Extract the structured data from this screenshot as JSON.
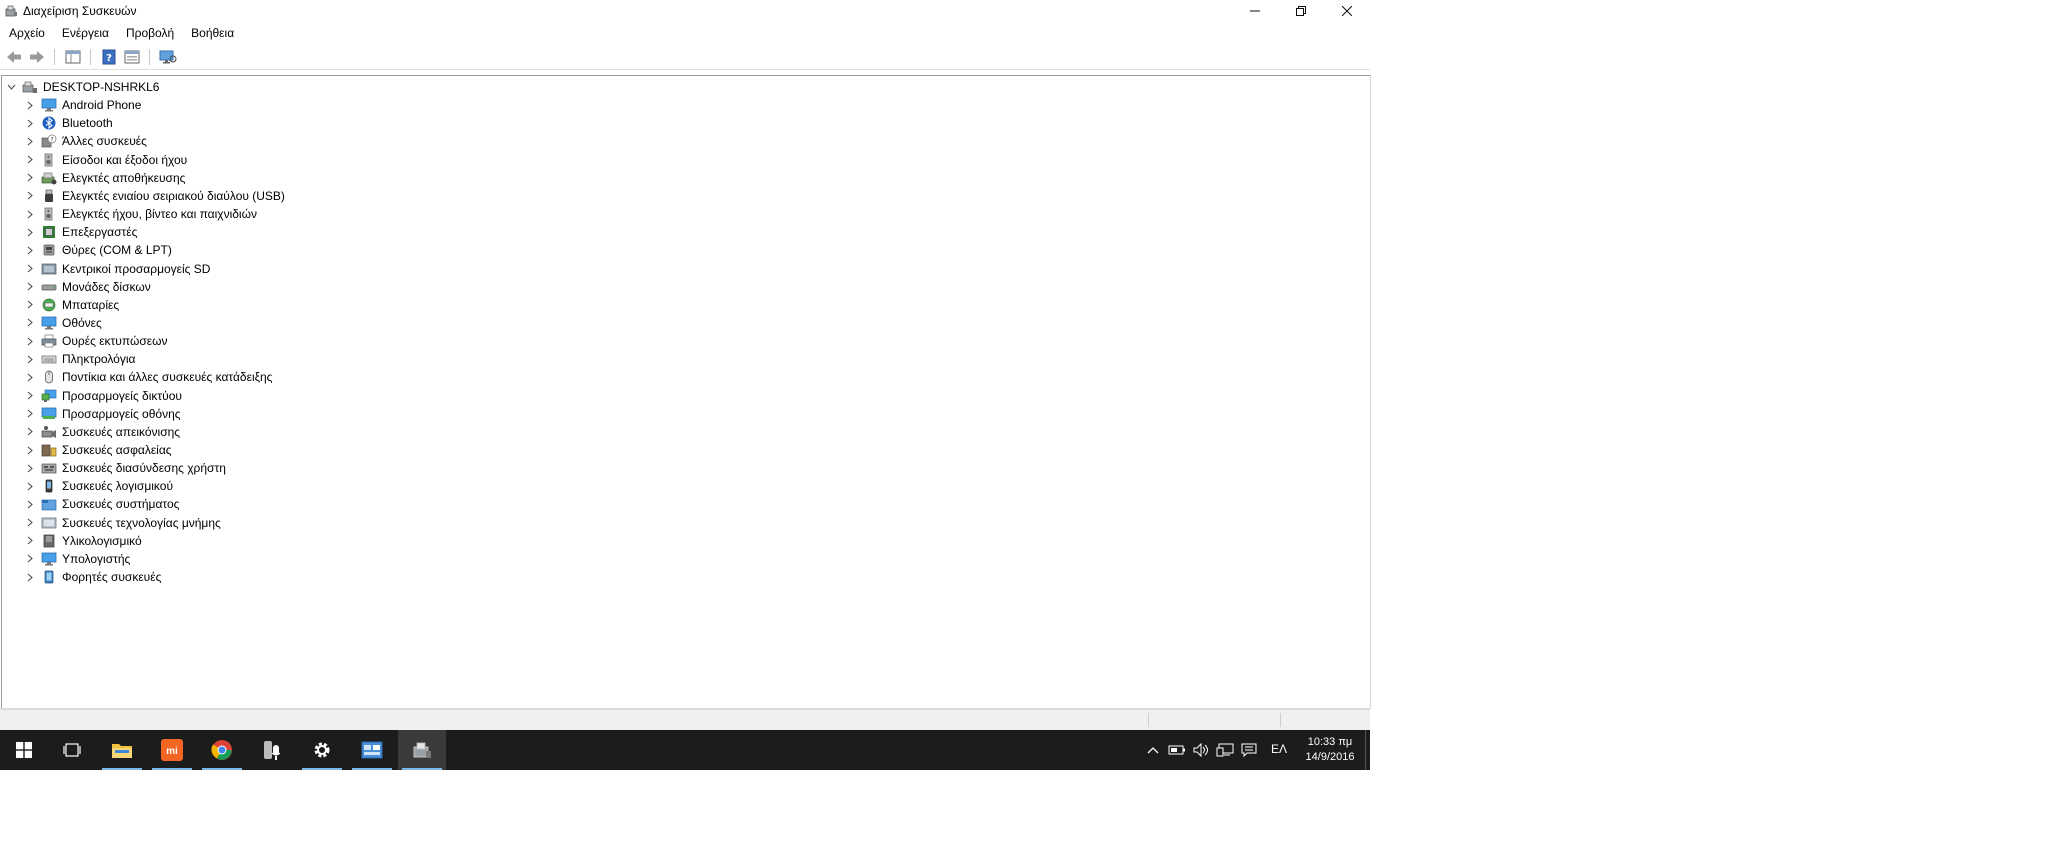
{
  "window": {
    "title": "Διαχείριση Συσκευών",
    "controls": {
      "minimize": "—",
      "restore": "❐",
      "close": "✕"
    }
  },
  "menu": [
    "Αρχείο",
    "Ενέργεια",
    "Προβολή",
    "Βοήθεια"
  ],
  "toolbar": {
    "buttons": [
      "back-icon",
      "forward-icon",
      "properties-panel-icon",
      "help-icon",
      "update-driver-icon",
      "monitor-scan-icon"
    ]
  },
  "tree": {
    "root": "DESKTOP-NSHRKL6",
    "items": [
      {
        "label": "Android Phone",
        "icon": "monitor-icon"
      },
      {
        "label": "Bluetooth",
        "icon": "bluetooth-icon"
      },
      {
        "label": "Άλλες συσκευές",
        "icon": "unknown-device-icon"
      },
      {
        "label": "Είσοδοι και έξοδοι ήχου",
        "icon": "speaker-icon"
      },
      {
        "label": "Ελεγκτές αποθήκευσης",
        "icon": "storage-controller-icon"
      },
      {
        "label": "Ελεγκτές ενιαίου σειριακού διαύλου (USB)",
        "icon": "usb-icon"
      },
      {
        "label": "Ελεγκτές ήχου, βίντεο και παιχνιδιών",
        "icon": "speaker-icon"
      },
      {
        "label": "Επεξεργαστές",
        "icon": "processor-icon"
      },
      {
        "label": "Θύρες (COM & LPT)",
        "icon": "port-icon"
      },
      {
        "label": "Κεντρικοί προσαρμογείς SD",
        "icon": "sd-host-icon"
      },
      {
        "label": "Μονάδες δίσκων",
        "icon": "disk-drive-icon"
      },
      {
        "label": "Μπαταρίες",
        "icon": "battery-icon"
      },
      {
        "label": "Οθόνες",
        "icon": "monitor-icon"
      },
      {
        "label": "Ουρές εκτυπώσεων",
        "icon": "printer-icon"
      },
      {
        "label": "Πληκτρολόγια",
        "icon": "keyboard-icon"
      },
      {
        "label": "Ποντίκια και άλλες συσκευές κατάδειξης",
        "icon": "mouse-icon"
      },
      {
        "label": "Προσαρμογείς δικτύου",
        "icon": "network-adapter-icon"
      },
      {
        "label": "Προσαρμογείς οθόνης",
        "icon": "display-adapter-icon"
      },
      {
        "label": "Συσκευές απεικόνισης",
        "icon": "camera-icon"
      },
      {
        "label": "Συσκευές ασφαλείας",
        "icon": "security-device-icon"
      },
      {
        "label": "Συσκευές διασύνδεσης χρήστη",
        "icon": "hid-icon"
      },
      {
        "label": "Συσκευές λογισμικού",
        "icon": "software-device-icon"
      },
      {
        "label": "Συσκευές συστήματος",
        "icon": "system-device-icon"
      },
      {
        "label": "Συσκευές τεχνολογίας μνήμης",
        "icon": "memory-device-icon"
      },
      {
        "label": "Υλικολογισμικό",
        "icon": "firmware-icon"
      },
      {
        "label": "Υπολογιστής",
        "icon": "computer-icon"
      },
      {
        "label": "Φορητές συσκευές",
        "icon": "portable-device-icon"
      }
    ]
  },
  "taskbar": {
    "apps": [
      "start-icon",
      "task-view-icon",
      "file-explorer-icon",
      "mi-icon",
      "chrome-icon",
      "microphone-icon",
      "settings-icon",
      "control-panel-icon",
      "device-manager-icon"
    ],
    "language": "ΕΛ",
    "time": "10:33 πμ",
    "date": "14/9/2016"
  },
  "colors": {
    "taskbar_bg": "#1c1c1c",
    "accent_underline": "#76b9ed"
  }
}
